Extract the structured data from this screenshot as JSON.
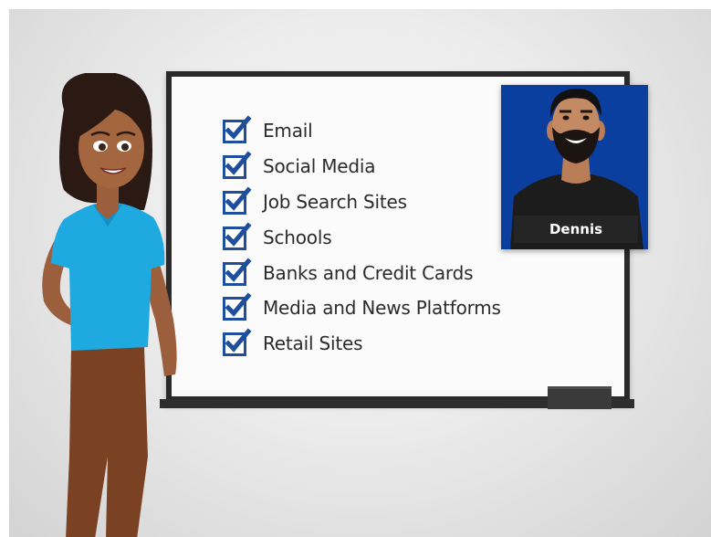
{
  "checklist": {
    "items": [
      {
        "label": "Email",
        "checked": true
      },
      {
        "label": "Social Media",
        "checked": true
      },
      {
        "label": "Job Search Sites",
        "checked": true
      },
      {
        "label": "Schools",
        "checked": true
      },
      {
        "label": "Banks and Credit Cards",
        "checked": true
      },
      {
        "label": "Media and News Platforms",
        "checked": true
      },
      {
        "label": "Retail Sites",
        "checked": true
      }
    ],
    "check_color": "#1f4e9c"
  },
  "video_card": {
    "name": "Dennis",
    "background_color": "#0b3f9f"
  },
  "presenter": {
    "shirt_color": "#1fa9e1",
    "pants_color": "#7a4223"
  }
}
